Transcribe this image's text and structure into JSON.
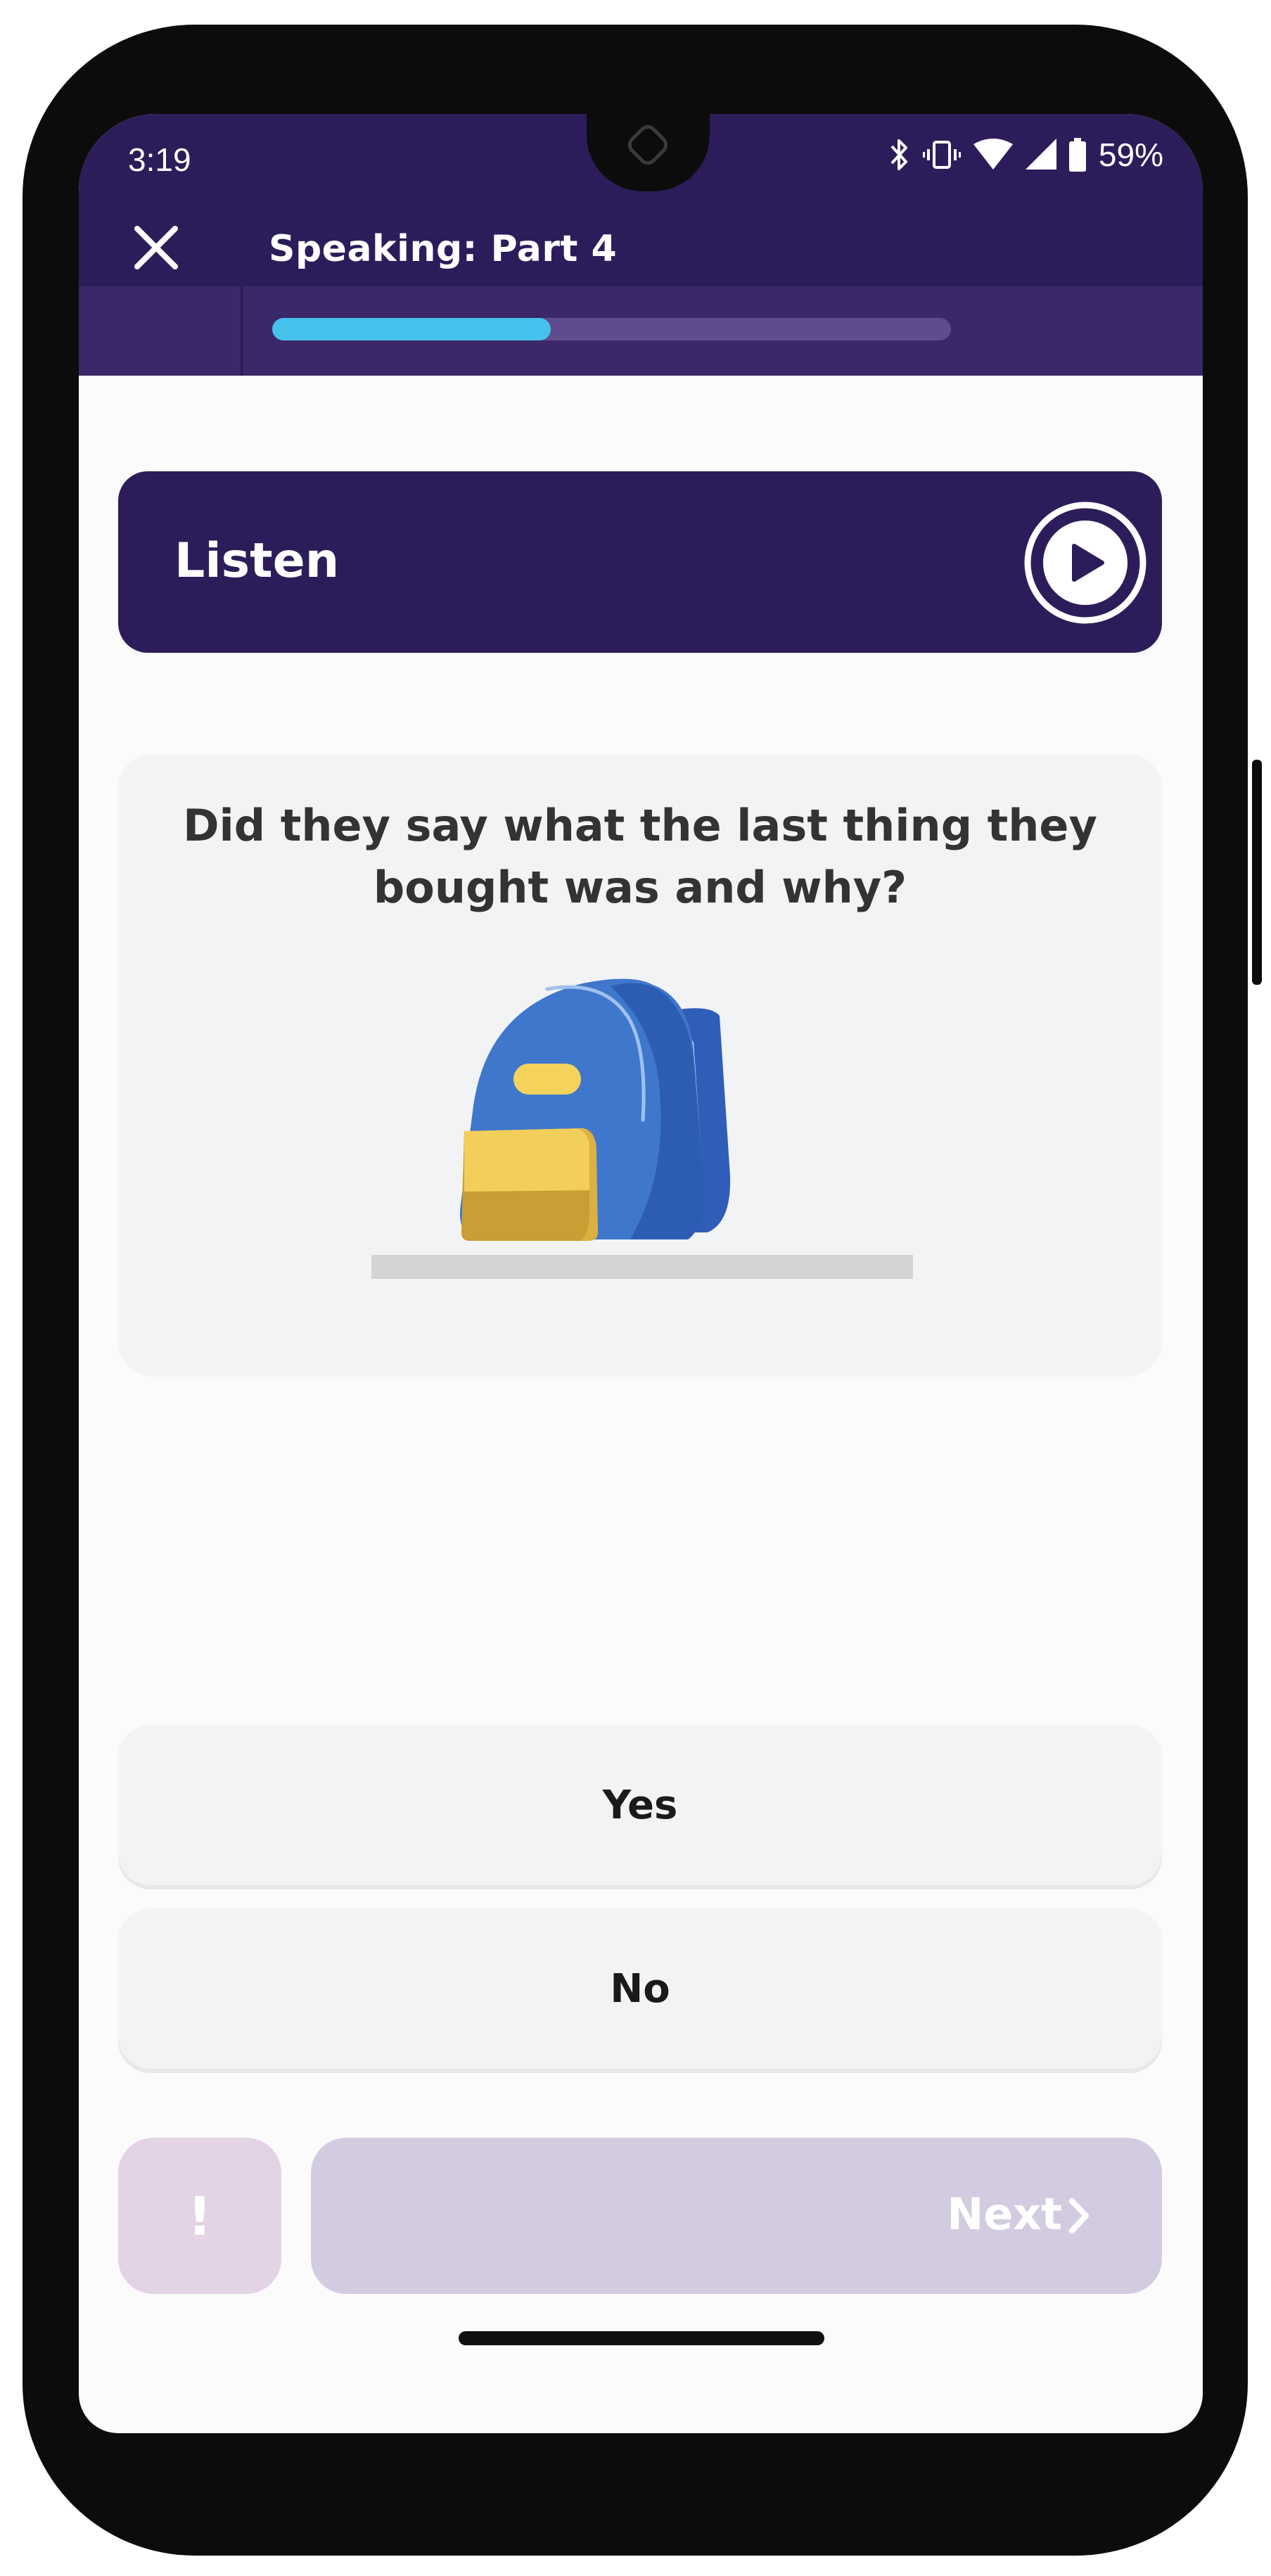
{
  "status_bar": {
    "time": "3:19",
    "battery_percent": "59%",
    "icons": [
      "bluetooth-icon",
      "vibrate-icon",
      "wifi-icon",
      "signal-icon",
      "battery-icon"
    ]
  },
  "header": {
    "title": "Speaking: Part 4",
    "close_icon": "close-icon",
    "progress": 0.41,
    "colors": {
      "header_bg": "#2c1d5a",
      "progress_fill": "#45c1ec",
      "progress_track": "#5f4c8c"
    }
  },
  "listen": {
    "label": "Listen",
    "icon": "play-icon"
  },
  "question": {
    "line1": "Did they say what the last thing they",
    "line2": "bought was and why?",
    "illustration": "backpack-illustration"
  },
  "answers": [
    {
      "label": "Yes"
    },
    {
      "label": "No"
    }
  ],
  "footer": {
    "report_label": "!",
    "next_label": "Next",
    "next_icon": "chevron-right-icon"
  }
}
